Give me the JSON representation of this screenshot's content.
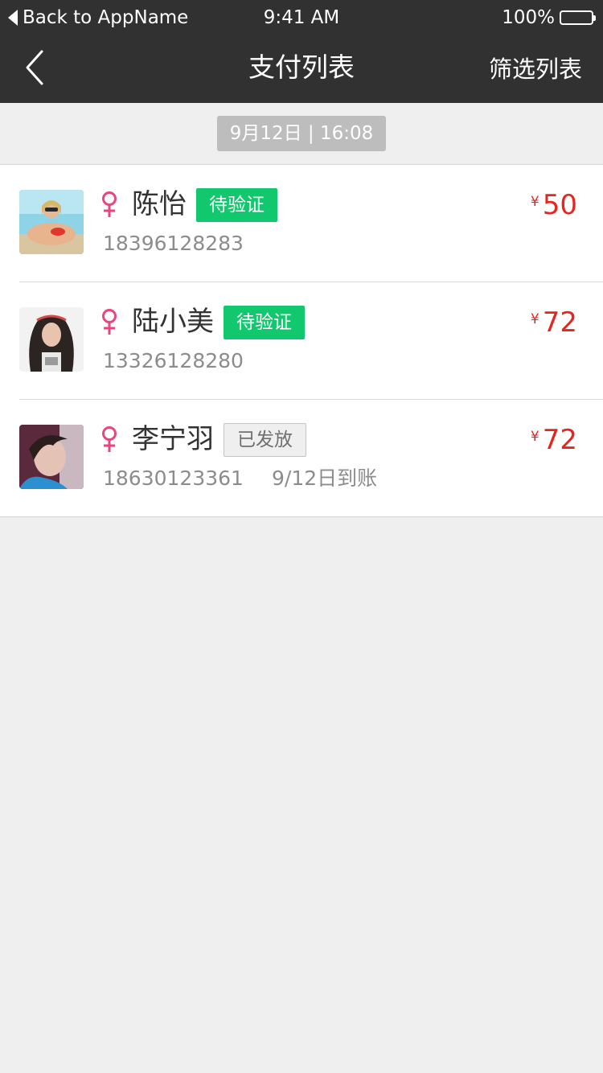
{
  "status_bar": {
    "back_to_app": "Back to AppName",
    "time": "9:41 AM",
    "battery": "100%"
  },
  "nav": {
    "title": "支付列表",
    "filter_label": "筛选列表"
  },
  "date_header": "9月12日 | 16:08",
  "currency_symbol": "¥",
  "gender_symbol": "♀",
  "colors": {
    "nav_bg": "#313131",
    "accent_green": "#11c86f",
    "amount_red": "#e5251e",
    "gender_pink": "#e8467c"
  },
  "payments": [
    {
      "name": "陈怡",
      "status": "待验证",
      "status_type": "pending",
      "phone": "18396128283",
      "arrival": "",
      "amount": "50"
    },
    {
      "name": "陆小美",
      "status": "待验证",
      "status_type": "pending",
      "phone": "13326128280",
      "arrival": "",
      "amount": "72"
    },
    {
      "name": "李宁羽",
      "status": "已发放",
      "status_type": "done",
      "phone": "18630123361",
      "arrival": "9/12日到账",
      "amount": "72"
    }
  ]
}
